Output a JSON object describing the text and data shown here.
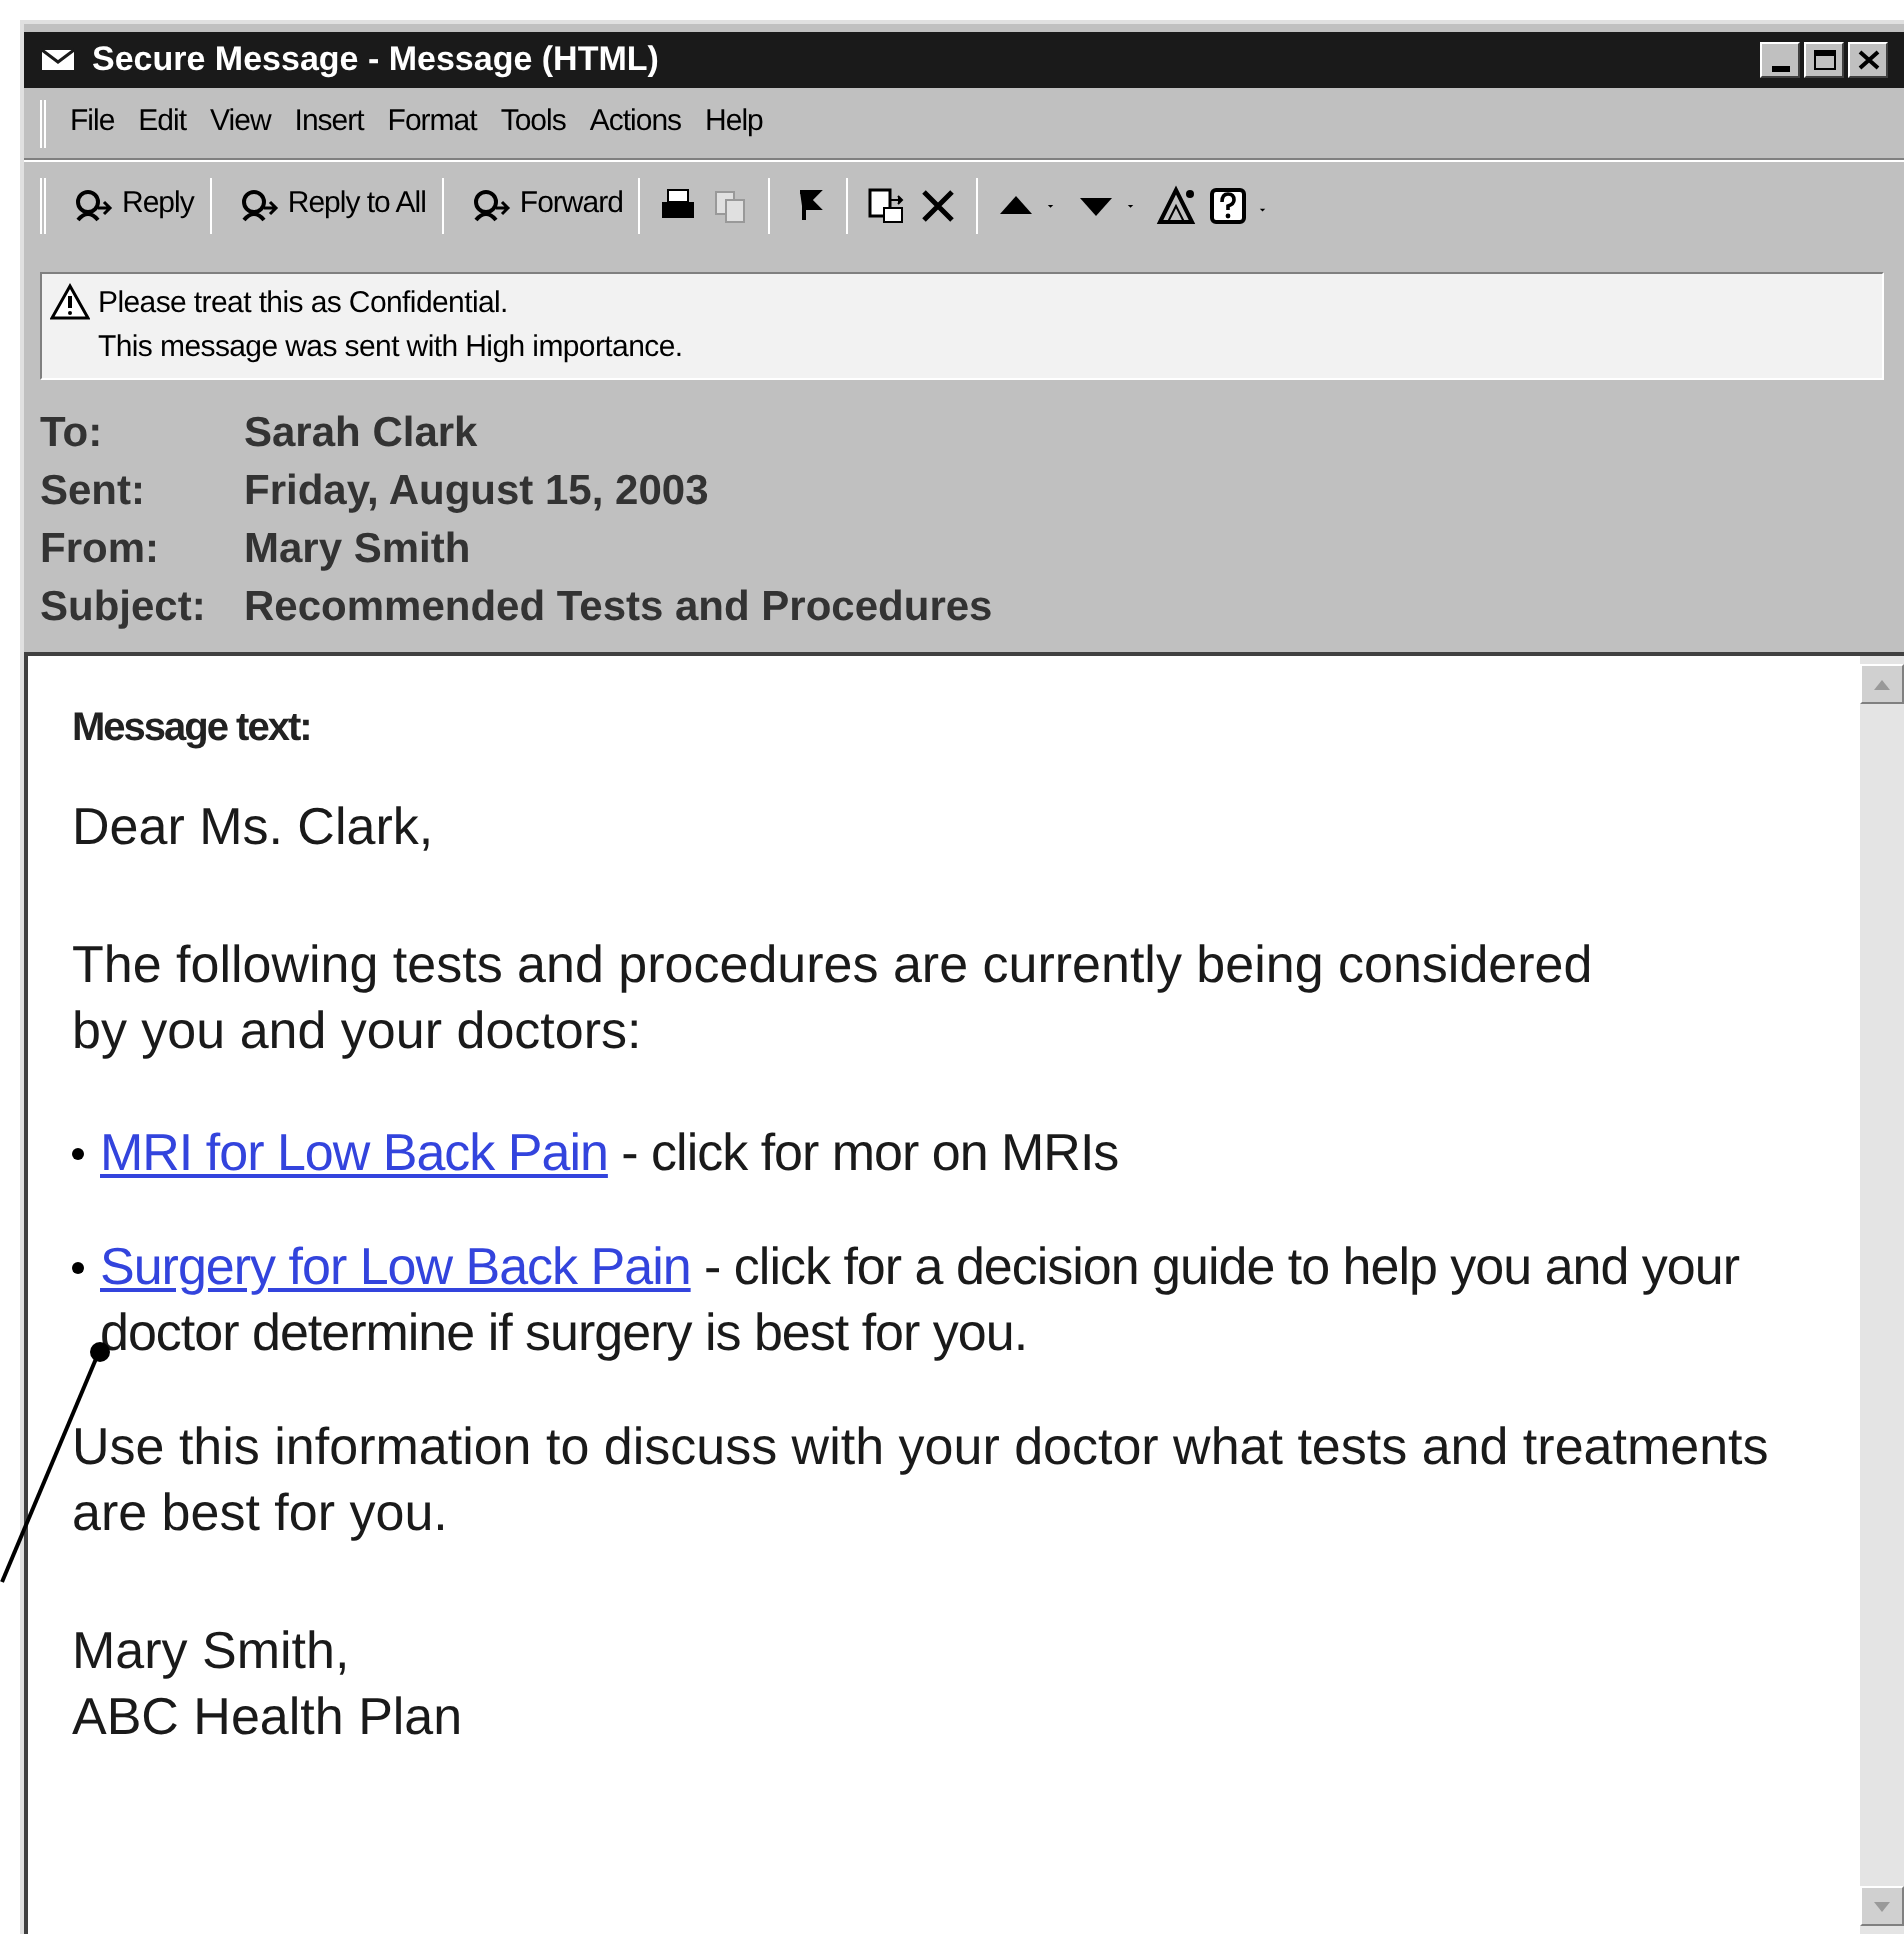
{
  "window": {
    "title": "Secure Message - Message (HTML)"
  },
  "menu": [
    "File",
    "Edit",
    "View",
    "Insert",
    "Format",
    "Tools",
    "Actions",
    "Help"
  ],
  "toolbar": [
    "Reply",
    "Reply to All",
    "Forward"
  ],
  "notice": [
    "Please treat this as Confidential.",
    "This message was sent with High importance."
  ],
  "headers": [
    {
      "label": "To:",
      "value": "Sarah Clark"
    },
    {
      "label": "Sent:",
      "value": "Friday, August 15, 2003"
    },
    {
      "label": "From:",
      "value": "Mary Smith"
    },
    {
      "label": "Subject:",
      "value": "Recommended Tests and Procedures"
    }
  ],
  "message": {
    "heading": "Message text:",
    "greeting": "Dear Ms. Clark,",
    "intro": "The following tests and procedures are currently being considered by you and your doctors:",
    "items": [
      {
        "link": "MRI for Low Back Pain",
        "text": " - click for mor on MRIs"
      },
      {
        "link": "Surgery for Low Back Pain",
        "text": " - click for a decision guide to help you and your doctor determine if surgery is best for you."
      }
    ],
    "closing": "Use this information to discuss with your doctor what tests and treatments are best for you.",
    "signature": [
      "Mary Smith,",
      "ABC Health Plan"
    ]
  }
}
